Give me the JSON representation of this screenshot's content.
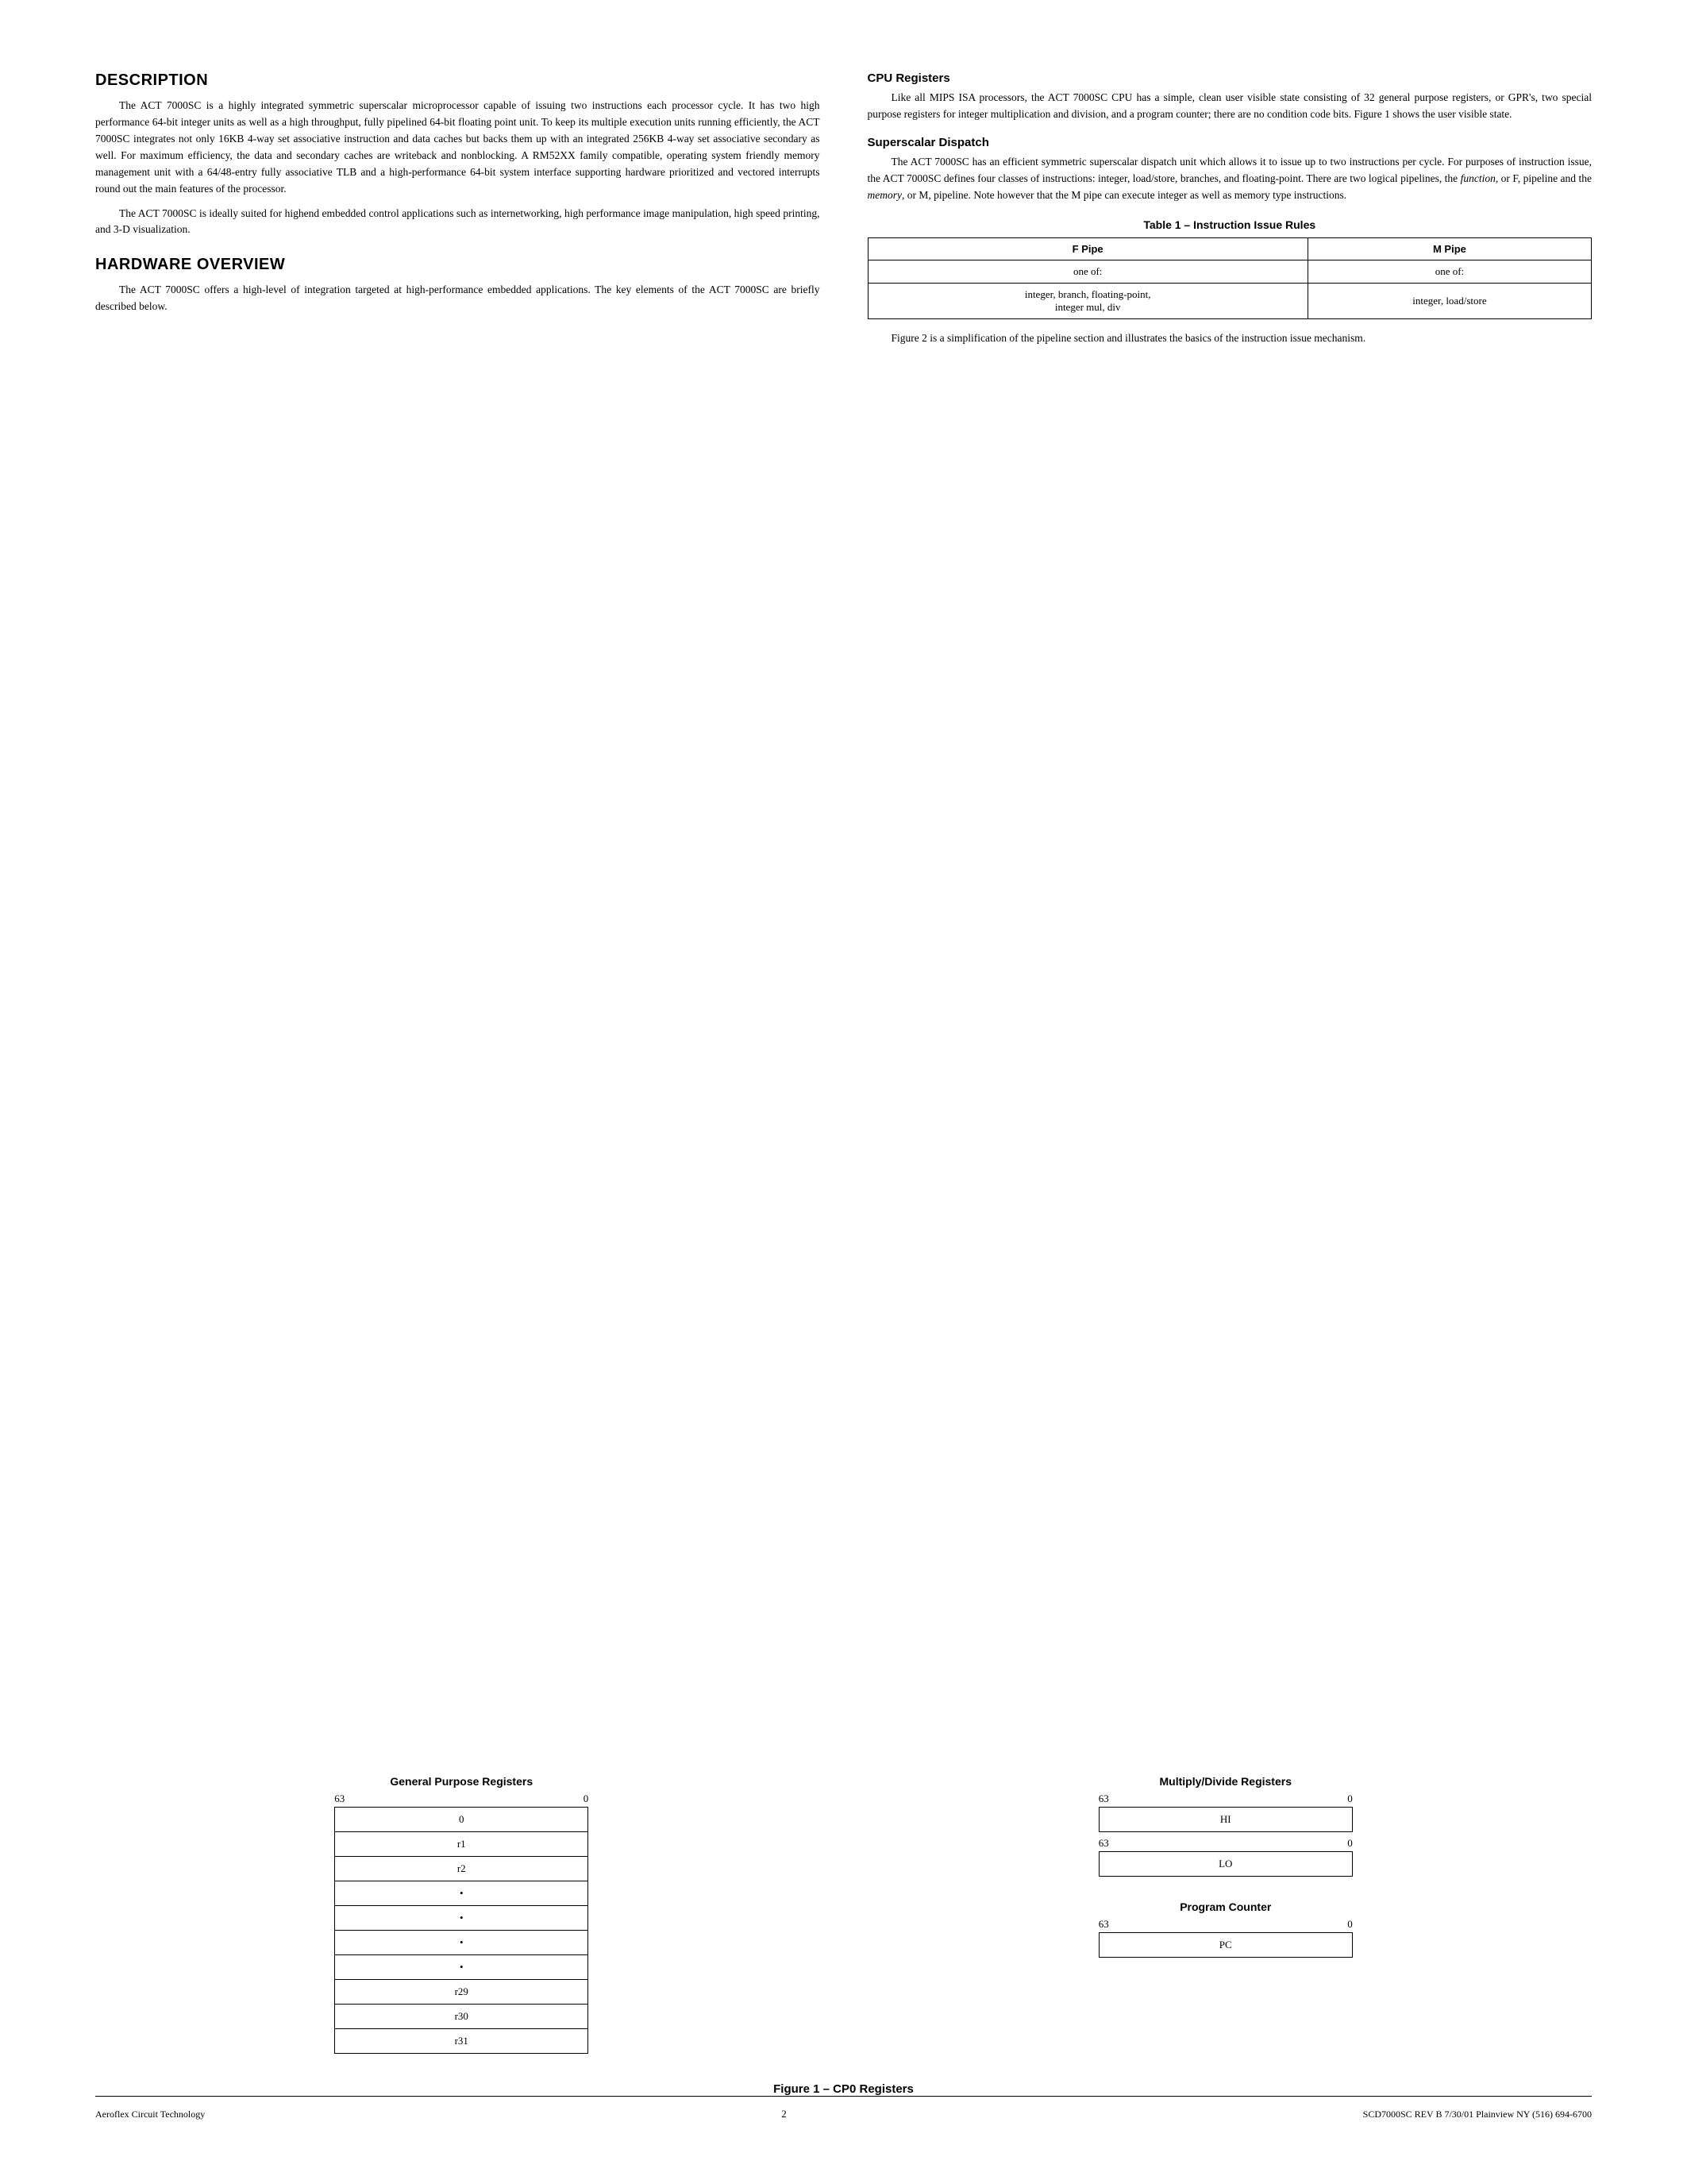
{
  "page": {
    "sections": {
      "description": {
        "title": "DESCRIPTION",
        "paragraphs": [
          "The ACT 7000SC is a highly integrated symmetric superscalar microprocessor capable of issuing two instructions each processor cycle. It has two high performance 64-bit integer units as well as a high throughput, fully pipelined 64-bit floating point unit. To keep its multiple execution units running efficiently, the ACT 7000SC integrates not only 16KB 4-way set associative instruction and data caches but backs them up with an integrated 256KB 4-way set associative secondary as well. For maximum efficiency, the data and secondary caches are writeback and nonblocking. A RM52XX family compatible, operating system friendly memory management unit with a 64/48-entry fully associative TLB and a high-performance 64-bit system interface supporting hardware prioritized and vectored interrupts round out the main features of the processor.",
          "The ACT 7000SC is ideally suited for highend embedded control applications such as internetworking, high performance image manipulation, high speed printing, and 3-D visualization."
        ]
      },
      "hardware_overview": {
        "title": "HARDWARE OVERVIEW",
        "paragraph": "The ACT 7000SC offers a high-level of integration targeted at high-performance embedded applications. The key elements of the ACT 7000SC are briefly described below."
      },
      "cpu_registers": {
        "title": "CPU Registers",
        "paragraph": "Like all MIPS ISA processors, the ACT 7000SC CPU has a simple, clean user visible state consisting of 32 general purpose registers, or GPR's, two special purpose registers for integer multiplication and division, and a program counter; there are no condition code bits. Figure 1 shows the user visible state."
      },
      "superscalar_dispatch": {
        "title": "Superscalar Dispatch",
        "paragraph": "The ACT 7000SC has an efficient symmetric superscalar dispatch unit which allows it to issue up to two instructions per cycle. For purposes of instruction issue, the ACT 7000SC defines four classes of instructions: integer, load/store, branches, and floating-point. There are two logical pipelines, the function, or F, pipeline and the memory, or M, pipeline. Note however that the M pipe can execute integer as well as memory type instructions."
      },
      "table": {
        "title": "Table 1 – Instruction Issue Rules",
        "headers": [
          "F Pipe",
          "M Pipe"
        ],
        "rows": [
          [
            "one of:",
            "one of:"
          ],
          [
            "integer, branch, floating-point,\ninteger mul, div",
            "integer, load/store"
          ]
        ]
      },
      "figure_note": "Figure 2 is a simplification of the pipeline section and illustrates the basics of the instruction issue mechanism."
    },
    "figure": {
      "caption": "Figure 1 – CP0 Registers",
      "gpr": {
        "title": "General Purpose Registers",
        "bit_high": "63",
        "bit_low": "0",
        "registers": [
          "0",
          "r1",
          "r2",
          "•",
          "•",
          "•",
          "•",
          "r29",
          "r30",
          "r31"
        ]
      },
      "mdr": {
        "title": "Multiply/Divide Registers",
        "bit_high": "63",
        "bit_low": "0",
        "hi_label": "HI",
        "lo_label": "LO"
      },
      "pc": {
        "title": "Program Counter",
        "bit_high": "63",
        "bit_low": "0",
        "label": "PC"
      }
    },
    "footer": {
      "left": "Aeroflex Circuit Technology",
      "center": "2",
      "right": "SCD7000SC REV B  7/30/01  Plainview NY (516) 694-6700"
    }
  }
}
